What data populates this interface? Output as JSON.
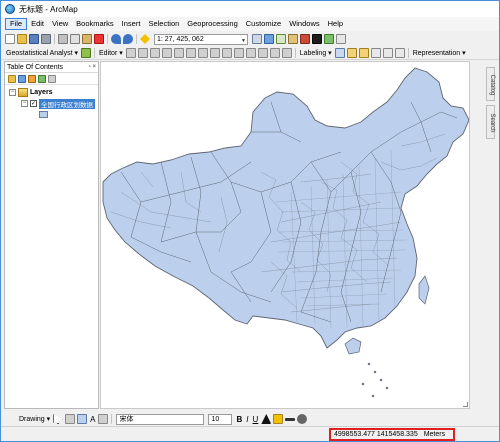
{
  "window": {
    "title": "无标题 - ArcMap"
  },
  "menu": [
    "File",
    "Edit",
    "View",
    "Bookmarks",
    "Insert",
    "Selection",
    "Geoprocessing",
    "Customize",
    "Windows",
    "Help"
  ],
  "toolbar": {
    "scale_value": "1: 27, 425, 062",
    "geostatistical_label": "Geostatistical Analyst ▾",
    "editor_label": "Editor ▾",
    "labeling_label": "Labeling ▾",
    "representation_label": "Representation ▾"
  },
  "toc": {
    "title": "Table Of Contents",
    "pin_glyph": "▫ ×",
    "layers_label": "Layers",
    "layer_name": "全国行政区划数据"
  },
  "side_tabs": [
    "Catalog",
    "Search"
  ],
  "drawing": {
    "drawing_label": "Drawing ▾",
    "font_name": "宋体",
    "font_size": "10",
    "bold": "B",
    "italic": "I",
    "underline": "U",
    "text_glyph": "A"
  },
  "status": {
    "x": "4998553.477",
    "y": "1415458.335",
    "units": "Meters"
  },
  "colors": {
    "accent": "#3c7fd1",
    "map_fill": "#bcd0ee",
    "map_stroke": "#5d6470",
    "highlight": "#e02020"
  }
}
